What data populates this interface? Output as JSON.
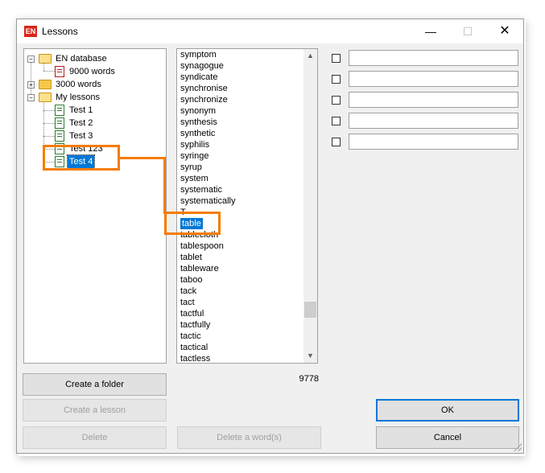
{
  "window": {
    "app_icon_text": "EN",
    "title": "Lessons",
    "minimize_glyph": "—",
    "maximize_glyph": "☐",
    "close_glyph": "✕"
  },
  "tree": {
    "items": [
      {
        "label": "EN database",
        "expander": "−"
      },
      {
        "label": "9000 words"
      },
      {
        "label": "3000 words",
        "expander": "+"
      },
      {
        "label": "My lessons",
        "expander": "−"
      },
      {
        "label": "Test 1"
      },
      {
        "label": "Test 2"
      },
      {
        "label": "Test 3"
      },
      {
        "label": "Test 123"
      },
      {
        "label": "Test 4"
      }
    ],
    "selected": "Test 4"
  },
  "word_list": {
    "items": [
      "symptom",
      "synagogue",
      "syndicate",
      "synchronise",
      "synchronize",
      "synonym",
      "synthesis",
      "synthetic",
      "syphilis",
      "syringe",
      "syrup",
      "system",
      "systematic",
      "systematically",
      "T",
      "table",
      "tablecloth",
      "tablespoon",
      "tablet",
      "tableware",
      "taboo",
      "tack",
      "tact",
      "tactful",
      "tactfully",
      "tactic",
      "tactical",
      "tactless"
    ],
    "selected": "table",
    "scroll_up_glyph": "▲",
    "scroll_down_glyph": "▼"
  },
  "word_count": "9778",
  "fields": [
    {
      "value": ""
    },
    {
      "value": ""
    },
    {
      "value": ""
    },
    {
      "value": ""
    },
    {
      "value": ""
    }
  ],
  "buttons": {
    "create_folder": "Create a folder",
    "create_lesson": "Create a lesson",
    "delete": "Delete",
    "delete_words": "Delete a word(s)",
    "ok": "OK",
    "cancel": "Cancel"
  },
  "colors": {
    "selection": "#0078d7",
    "highlight": "#f57c00"
  }
}
